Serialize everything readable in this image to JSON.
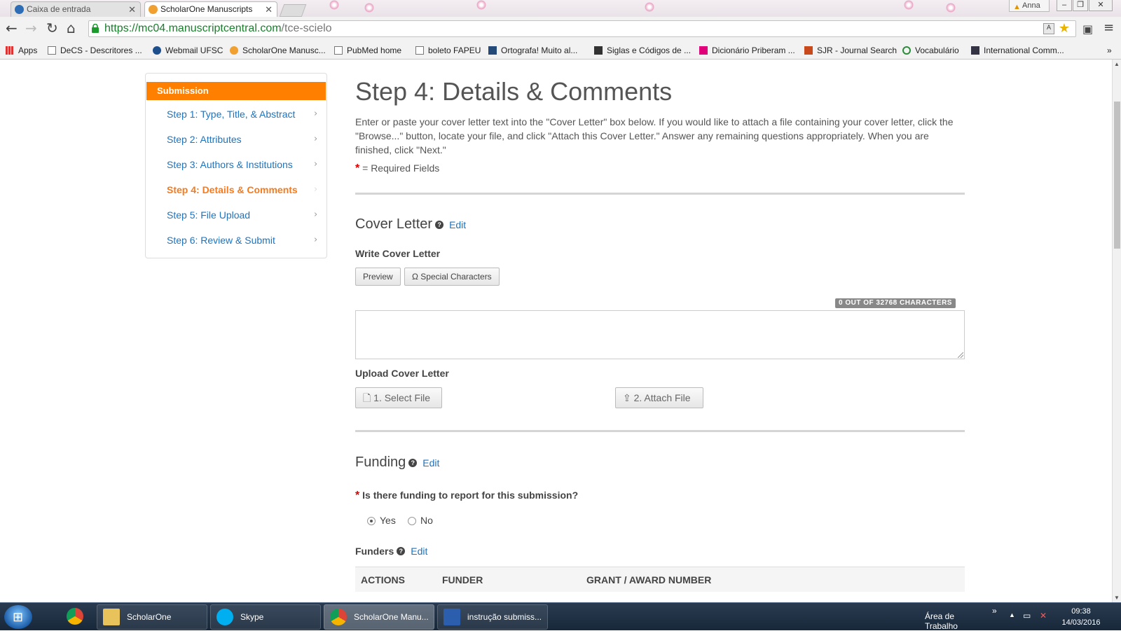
{
  "browser": {
    "tabs": [
      {
        "title": "Caixa de entrada",
        "icon": "outlook-icon"
      },
      {
        "title": "ScholarOne Manuscripts",
        "icon": "scholarone-icon"
      }
    ],
    "user_name": "Anna",
    "url_host": "https://mc04.manuscriptcentral.com",
    "url_path": "/tce-scielo",
    "bookmarks": [
      {
        "label": "Apps",
        "icon": "apps-grid-icon"
      },
      {
        "label": "DeCS - Descritores ...",
        "icon": "page-icon"
      },
      {
        "label": "Webmail UFSC",
        "icon": "webmail-icon"
      },
      {
        "label": "ScholarOne Manusc...",
        "icon": "scholarone-icon"
      },
      {
        "label": "PubMed home",
        "icon": "page-icon"
      },
      {
        "label": "boleto FAPEU",
        "icon": "page-icon"
      },
      {
        "label": "Ortografa! Muito al...",
        "icon": "ortografa-icon"
      },
      {
        "label": "Siglas e Códigos de ...",
        "icon": "siglas-icon"
      },
      {
        "label": "Dicionário Priberam ...",
        "icon": "priberam-icon"
      },
      {
        "label": "SJR - Journal Search",
        "icon": "sjr-icon"
      },
      {
        "label": "Vocabulário",
        "icon": "vocabulario-icon"
      },
      {
        "label": "International Comm...",
        "icon": "icmje-icon"
      }
    ]
  },
  "sidebar": {
    "header": "Submission",
    "steps": [
      {
        "label": "Step 1: Type, Title, & Abstract",
        "current": false
      },
      {
        "label": "Step 2: Attributes",
        "current": false
      },
      {
        "label": "Step 3: Authors & Institutions",
        "current": false
      },
      {
        "label": "Step 4: Details & Comments",
        "current": true
      },
      {
        "label": "Step 5: File Upload",
        "current": false
      },
      {
        "label": "Step 6: Review & Submit",
        "current": false
      }
    ]
  },
  "main": {
    "title": "Step 4: Details & Comments",
    "intro": "Enter or paste your cover letter text into the \"Cover Letter\" box below. If you would like to attach a file containing your cover letter, click the \"Browse...\" button, locate your file, and click \"Attach this Cover Letter.\" Answer any remaining questions appropriately. When you are finished, click \"Next.\"",
    "required_star": "*",
    "required_note": "= Required Fields",
    "cover_letter": {
      "title": "Cover Letter",
      "edit": "Edit",
      "write_label": "Write Cover Letter",
      "preview_btn": "Preview",
      "special_chars_btn": "Ω Special Characters",
      "counter": "0 OUT OF 32768 CHARACTERS",
      "upload_label": "Upload Cover Letter",
      "select_file_btn": "1. Select File",
      "attach_file_btn": "2. Attach File"
    },
    "funding": {
      "title": "Funding",
      "edit": "Edit",
      "question": "Is there funding to report for this submission?",
      "options": [
        "Yes",
        "No"
      ],
      "selected": "Yes",
      "funders_label": "Funders",
      "funders_edit": "Edit",
      "columns": [
        "ACTIONS",
        "FUNDER",
        "GRANT / AWARD NUMBER"
      ]
    }
  },
  "taskbar": {
    "items": [
      {
        "label": "",
        "icon": "chrome-icon"
      },
      {
        "label": "ScholarOne",
        "icon": "folder-icon"
      },
      {
        "label": "Skype",
        "icon": "skype-icon"
      },
      {
        "label": "ScholarOne Manu...",
        "icon": "chrome-icon"
      },
      {
        "label": "instrução submiss...",
        "icon": "word-icon"
      }
    ],
    "tray_label": "Área de Trabalho",
    "chevron": "»",
    "time": "09:38",
    "date": "14/03/2016"
  },
  "colors": {
    "accent_orange": "#ff8000",
    "link_blue": "#1e73be",
    "required_red": "#dd0000"
  }
}
